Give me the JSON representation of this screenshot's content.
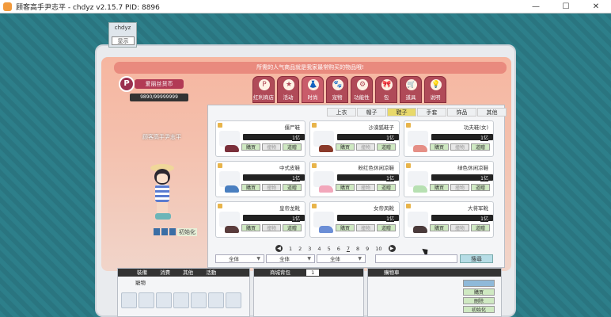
{
  "window": {
    "title": "顾客高手尹志平 - chdyz v2.15.7    PID: 8896",
    "min": "—",
    "max": "☐",
    "close": "✕"
  },
  "popup": {
    "name": "chdyz",
    "button": "显示"
  },
  "banner": "所需的人气商品就是我家最常购买的物品哦!",
  "badge": {
    "label": "爱丽丝货币",
    "count": "9890/99999999"
  },
  "character": {
    "name": "顾客高手尹志平",
    "guild_icons": [
      "a",
      "b",
      "c"
    ],
    "guild": "初始化"
  },
  "tabs": [
    {
      "label": "红利商店",
      "icon": "P"
    },
    {
      "label": "活动",
      "icon": "★"
    },
    {
      "label": "时尚",
      "icon": "👗"
    },
    {
      "label": "宠物",
      "icon": "🐾"
    },
    {
      "label": "功能性",
      "icon": "⚙"
    },
    {
      "label": "包",
      "icon": "🎀"
    },
    {
      "label": "道具",
      "icon": "🛒"
    },
    {
      "label": "说明",
      "icon": "💡"
    }
  ],
  "subtabs": [
    "上衣",
    "帽子",
    "鞋子",
    "手套",
    "饰品",
    "其他"
  ],
  "items": [
    {
      "name": "僵尸鞋",
      "price": "1亿",
      "color": "#7a2f3a"
    },
    {
      "name": "沙漠狐鞋子",
      "price": "1亿",
      "color": "#8a3a2a"
    },
    {
      "name": "功夫鞋(女)",
      "price": "1亿",
      "color": "#e58f86"
    },
    {
      "name": "中式皮鞋",
      "price": "1亿",
      "color": "#4a7fc0"
    },
    {
      "name": "粉红色休闲凉鞋",
      "price": "1亿",
      "color": "#f2a7bb"
    },
    {
      "name": "绿色休闲凉鞋",
      "price": "1亿",
      "color": "#b7e0b2"
    },
    {
      "name": "皇帝龙靴",
      "price": "1亿",
      "color": "#5a3c3c"
    },
    {
      "name": "女帝凤靴",
      "price": "1亿",
      "color": "#6b8ed6"
    },
    {
      "name": "大将军靴",
      "price": "1亿",
      "color": "#4a3a3a"
    }
  ],
  "item_actions": {
    "buy": "購買",
    "try": "撞物",
    "gift": "道贈"
  },
  "pager": {
    "prev": "◀",
    "next": "▶",
    "pages": [
      "1",
      "2",
      "3",
      "4",
      "5",
      "6",
      "7",
      "8",
      "9",
      "10"
    ]
  },
  "filters": [
    "全体",
    "全体",
    "全体"
  ],
  "search_button": "搜尋",
  "inventory": {
    "tabs": [
      "裝備",
      "消費",
      "其他",
      "活動"
    ],
    "tab2": "寵物"
  },
  "shop_bag": {
    "title": "商城背包",
    "page": "1"
  },
  "cart": {
    "title": "購物車",
    "buttons": [
      "購買",
      "刪除",
      "初始化"
    ]
  }
}
